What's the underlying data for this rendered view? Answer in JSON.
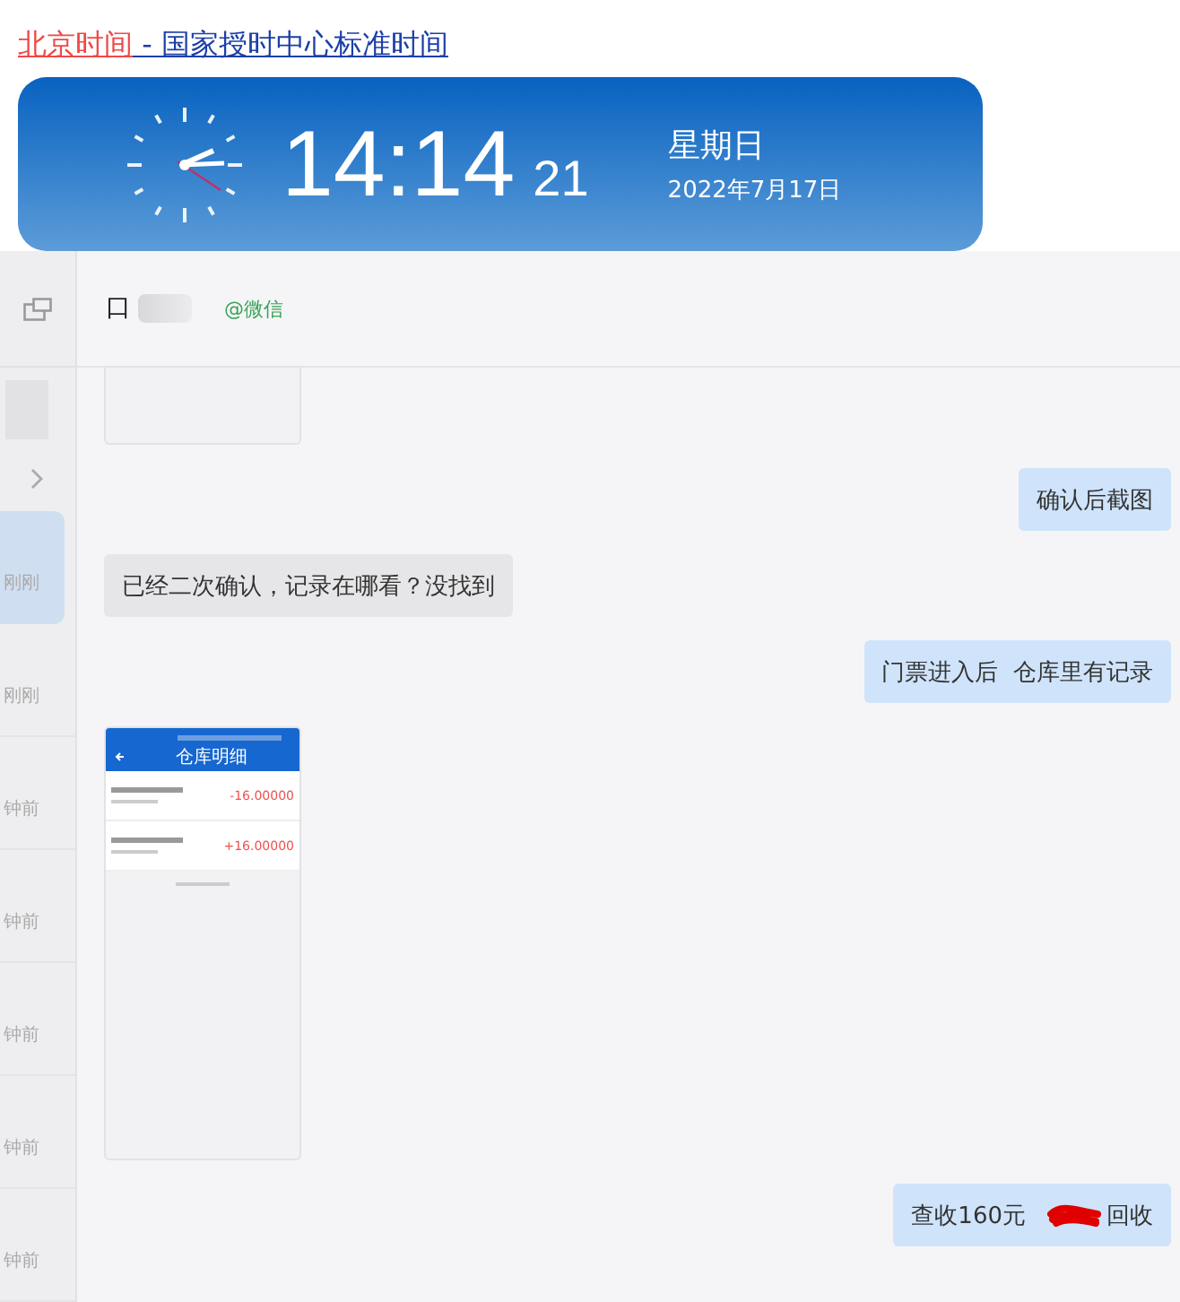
{
  "page_title": {
    "highlight": "北京时间",
    "rest": " - 国家授时中心标准时间"
  },
  "clock": {
    "time": "14:14",
    "seconds": "21",
    "weekday": "星期日",
    "date": "2022年7月17日"
  },
  "sidebar": {
    "sessions": [
      {
        "time": "刚刚",
        "selected": true
      },
      {
        "time": "刚刚",
        "selected": false
      },
      {
        "time": "钟前",
        "selected": false
      },
      {
        "time": "钟前",
        "selected": false
      },
      {
        "time": "钟前",
        "selected": false
      },
      {
        "time": "钟前",
        "selected": false
      },
      {
        "time": "钟前",
        "selected": false
      }
    ]
  },
  "chat_header": {
    "name": "口",
    "source": "@微信"
  },
  "messages": [
    {
      "kind": "image",
      "outgoing": false,
      "cut": true
    },
    {
      "kind": "text",
      "outgoing": true,
      "text": "确认后截图"
    },
    {
      "kind": "text",
      "outgoing": false,
      "text": "已经二次确认，记录在哪看？没找到"
    },
    {
      "kind": "text",
      "outgoing": true,
      "text": "门票进入后  仓库里有记录"
    },
    {
      "kind": "screenshot",
      "outgoing": false,
      "title": "仓库明细",
      "amounts": [
        {
          "value": "-16.00000"
        },
        {
          "value": "+16.00000"
        }
      ]
    },
    {
      "kind": "redacted",
      "outgoing": true,
      "parts": [
        "查收160元",
        "回收"
      ]
    }
  ]
}
